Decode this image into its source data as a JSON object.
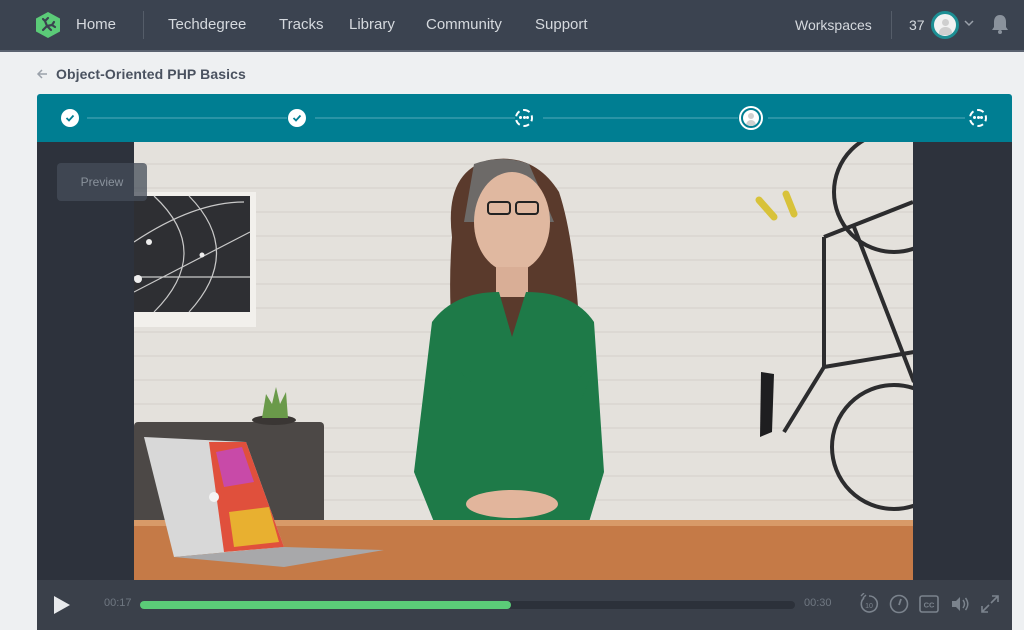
{
  "nav": {
    "home": "Home",
    "links": [
      "Techdegree",
      "Tracks",
      "Library",
      "Community",
      "Support"
    ],
    "workspaces": "Workspaces",
    "points": "37",
    "brand_color": "#5bcb78",
    "icons": {
      "logo": "treehouse-logo-icon",
      "avatar": "user-avatar",
      "caret": "chevron-down-icon",
      "bell": "bell-icon"
    }
  },
  "breadcrumb": {
    "back_icon": "arrow-left-icon",
    "title": "Object-Oriented PHP Basics"
  },
  "stages": {
    "accent_color": "#007e92",
    "items": [
      {
        "state": "completed",
        "icon": "check-icon"
      },
      {
        "state": "completed",
        "icon": "check-icon"
      },
      {
        "state": "upcoming",
        "icon": "quiz-dots-icon"
      },
      {
        "state": "current",
        "icon": "video-person-icon"
      },
      {
        "state": "upcoming",
        "icon": "quiz-dots-icon"
      }
    ]
  },
  "player": {
    "preview_label": "Preview",
    "current_time": "00:17",
    "duration": "00:30",
    "progress": 0.567,
    "progress_color": "#5bcb78",
    "controls": {
      "play": "play-icon",
      "rewind": "rewind-10-icon",
      "speed": "playback-speed-icon",
      "captions": "closed-captions-icon",
      "volume": "volume-icon",
      "fullscreen": "fullscreen-icon"
    },
    "rewind_label": "10",
    "captions_label": "CC"
  }
}
